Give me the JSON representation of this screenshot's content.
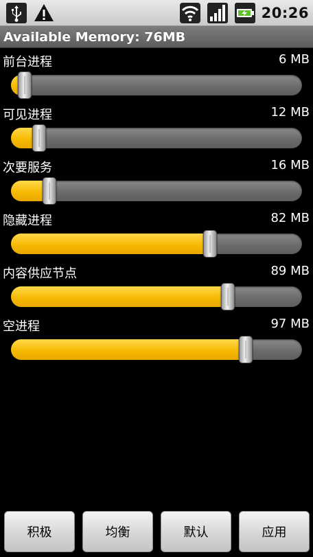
{
  "status_bar": {
    "time": "20:26",
    "icons": [
      "usb-icon",
      "warning-icon",
      "wifi-icon",
      "signal-icon",
      "battery-charging-icon"
    ]
  },
  "title": "Available Memory: 76MB",
  "colors": {
    "fill": "#f5b800",
    "track": "#6a6a6a",
    "titlebar": "#6a6a6a",
    "statusbar": "#d4d4d4"
  },
  "rows": [
    {
      "label": "前台进程",
      "value": "6 MB",
      "level": 0.047
    },
    {
      "label": "可见进程",
      "value": "12 MB",
      "level": 0.097
    },
    {
      "label": "次要服务",
      "value": "16 MB",
      "level": 0.132
    },
    {
      "label": "隐藏进程",
      "value": "82 MB",
      "level": 0.684
    },
    {
      "label": "内容供应节点",
      "value": "89 MB",
      "level": 0.745
    },
    {
      "label": "空进程",
      "value": "97 MB",
      "level": 0.807
    }
  ],
  "buttons": {
    "aggressive": "积极",
    "balanced": "均衡",
    "default": "默认",
    "apply": "应用"
  }
}
